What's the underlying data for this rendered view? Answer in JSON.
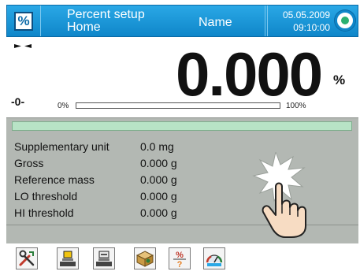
{
  "header": {
    "mode_icon_glyph": "%",
    "title_line1": "Percent setup",
    "title_line2": "Home",
    "user": "Name",
    "date": "05.05.2009",
    "time": "09:10:00",
    "right_icon": "target-icon"
  },
  "display": {
    "zero_indicator": "-0-",
    "value": "0.000",
    "unit": "%",
    "bar_min_label": "0%",
    "bar_max_label": "100%",
    "bar_fill_fraction": 0.0,
    "stability_icon": "stability-marker-icon"
  },
  "info_rows": [
    {
      "label": "Supplementary unit",
      "value": "0.0 mg"
    },
    {
      "label": "Gross",
      "value": "0.000 g"
    },
    {
      "label": "Reference mass",
      "value": "0.000 g"
    },
    {
      "label": "LO threshold",
      "value": "0.000 g"
    },
    {
      "label": "HI threshold",
      "value": "0.000 g"
    }
  ],
  "toolbar": [
    {
      "icon": "tools-icon"
    },
    {
      "icon": "scale-tare-icon"
    },
    {
      "icon": "scale-reference-icon"
    },
    {
      "icon": "package-icon"
    },
    {
      "icon": "percent-question-icon"
    },
    {
      "icon": "checkweigher-gauge-icon"
    }
  ],
  "colors": {
    "header_blue": "#0f86c9",
    "panel_gray": "#b3b8b3",
    "green_bar": "#b8e3c6"
  }
}
